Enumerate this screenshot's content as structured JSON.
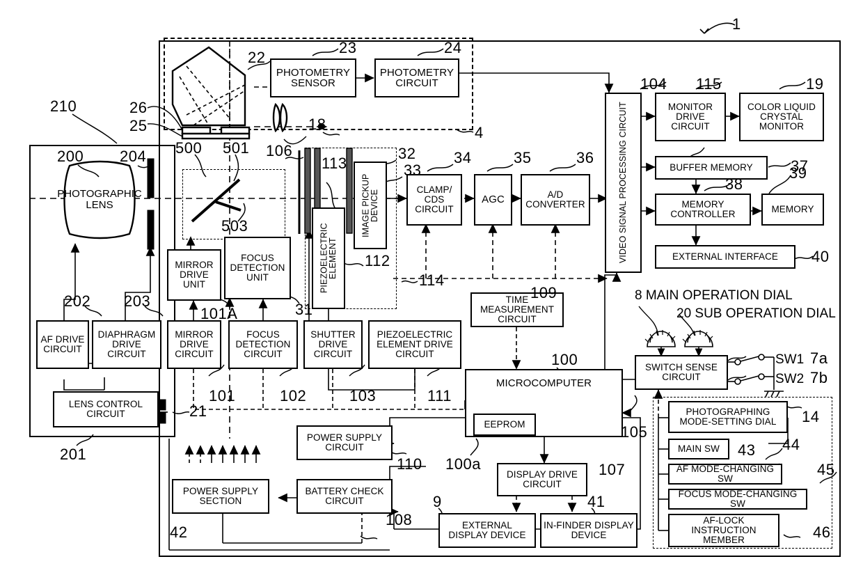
{
  "figure": {
    "label_1": "1",
    "label_4": "4",
    "type": "patent-block-diagram"
  },
  "optical": {
    "pentaprism_ref": "22",
    "focusing_screen_ref": "26",
    "screen_ref2": "25",
    "eyepiece_ref": "18",
    "photometry_sensor": "PHOTOMETRY\nSENSOR",
    "photometry_sensor_label": "PHOTOMETRY SENSOR",
    "photometry_sensor_ref": "23",
    "photometry_circuit_label": "PHOTOMETRY CIRCUIT",
    "photometry_circuit_ref": "24"
  },
  "lens_unit": {
    "ref": "210",
    "photographic_lens": "PHOTOGRAPHIC LENS",
    "photographic_lens_ref": "200",
    "diaphragm_ref": "204",
    "af_drive_circuit": "AF DRIVE CIRCUIT",
    "af_drive_circuit_ref": "202",
    "diaphragm_drive_circuit": "DIAPHRAGM DRIVE CIRCUIT",
    "diaphragm_drive_circuit_ref": "203",
    "lens_control_circuit": "LENS CONTROL CIRCUIT",
    "lens_control_circuit_ref": "201",
    "mount_contact_ref": "21"
  },
  "mirror_box": {
    "ref_500": "500",
    "ref_501": "501",
    "ref_503": "503",
    "mirror_drive_unit": "MIRROR DRIVE UNIT",
    "focus_detection_unit": "FOCUS DETECTION UNIT",
    "focus_detection_unit_ref": "31",
    "mirror_drive_unit_ref": "101A"
  },
  "imaging": {
    "shutter_ref": "106",
    "filter_ref": "113",
    "image_pickup_device": "IMAGE PICKUP DEVICE",
    "image_pickup_device_ref": "32",
    "piezoelectric_element": "PIEZOELECTRIC ELEMENT",
    "piezoelectric_element_ref": "112",
    "dust_unit_ref": "114",
    "clamp_cds_circuit": "CLAMP/ CDS CIRCUIT",
    "clamp_cds_circuit_ref": "33",
    "clamp_cds_circuit_ref2": "34",
    "agc": "AGC",
    "agc_ref": "35",
    "ad_converter": "A/D CONVERTER",
    "ad_converter_ref": "36"
  },
  "video": {
    "video_signal_processing_circuit": "VIDEO SIGNAL PROCESSING CIRCUIT",
    "video_signal_processing_circuit_ref": "104",
    "monitor_drive_circuit": "MONITOR DRIVE CIRCUIT",
    "monitor_drive_circuit_ref": "115",
    "color_liquid_crystal_monitor": "COLOR LIQUID CRYSTAL MONITOR",
    "color_liquid_crystal_monitor_ref": "19",
    "buffer_memory": "BUFFER MEMORY",
    "buffer_memory_ref": "37",
    "memory_controller": "MEMORY CONTROLLER",
    "memory_controller_ref": "38",
    "memory": "MEMORY",
    "memory_ref": "39",
    "external_interface": "EXTERNAL INTERFACE",
    "external_interface_ref": "40"
  },
  "drive_circuits": {
    "mirror_drive_circuit": "MIRROR DRIVE CIRCUIT",
    "mirror_drive_circuit_ref": "101",
    "focus_detection_circuit": "FOCUS DETECTION CIRCUIT",
    "focus_detection_circuit_ref": "102",
    "shutter_drive_circuit": "SHUTTER DRIVE CIRCUIT",
    "shutter_drive_circuit_ref": "103",
    "piezoelectric_element_drive_circuit": "PIEZOELECTRIC ELEMENT DRIVE CIRCUIT",
    "piezoelectric_element_drive_circuit_ref": "111"
  },
  "control": {
    "time_measurement_circuit": "TIME MEASUREMENT CIRCUIT",
    "time_measurement_circuit_ref": "109",
    "microcomputer": "MICROCOMPUTER",
    "microcomputer_ref": "100",
    "eeprom": "EEPROM",
    "eeprom_ref": "100a"
  },
  "power": {
    "power_supply_circuit": "POWER SUPPLY CIRCUIT",
    "power_supply_circuit_ref": "110",
    "battery_check_circuit": "BATTERY CHECK CIRCUIT",
    "battery_check_circuit_ref": "108",
    "power_supply_section": "POWER SUPPLY SECTION",
    "power_supply_section_ref": "42"
  },
  "display": {
    "display_drive_circuit": "DISPLAY DRIVE CIRCUIT",
    "display_drive_circuit_ref": "107",
    "external_display_device": "EXTERNAL DISPLAY DEVICE",
    "external_display_device_ref": "9",
    "in_finder_display_device": "IN-FINDER DISPLAY DEVICE",
    "in_finder_display_device_ref": "41"
  },
  "switches": {
    "switch_sense_circuit": "SWITCH SENSE CIRCUIT",
    "switch_sense_circuit_ref": "105",
    "main_operation_dial": "8 MAIN OPERATION DIAL",
    "sub_operation_dial": "20 SUB OPERATION DIAL",
    "sw1": "SW1",
    "sw1_ref": "7a",
    "sw2": "SW2",
    "sw2_ref": "7b",
    "photographing_mode_setting_dial": "PHOTOGRAPHING MODE-SETTING DIAL",
    "photographing_mode_setting_dial_ref": "14",
    "main_sw": "MAIN SW",
    "main_sw_ref": "43",
    "af_mode_changing_sw": "AF MODE-CHANGING SW",
    "af_mode_changing_sw_ref": "44",
    "focus_mode_changing_sw": "FOCUS MODE-CHANGING SW",
    "focus_mode_changing_sw_ref": "45",
    "af_lock_instruction_member": "AF-LOCK INSTRUCTION MEMBER",
    "af_lock_instruction_member_ref": "46"
  },
  "colors": {
    "line": "#000000",
    "background": "#ffffff"
  }
}
